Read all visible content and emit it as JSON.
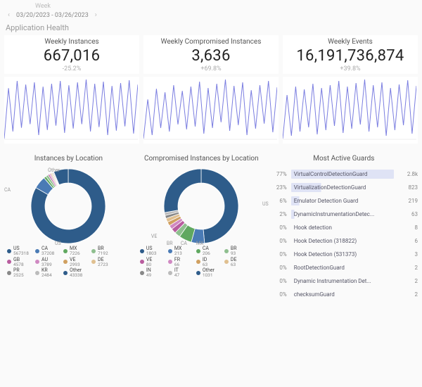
{
  "header": {
    "week_label": "Week",
    "date_range": "03/20/2023 - 03/26/2023"
  },
  "section_title": "Application Health",
  "kpis": [
    {
      "title": "Weekly Instances",
      "value": "667,016",
      "delta": "-25.2%"
    },
    {
      "title": "Weekly Compromised Instances",
      "value": "3,636",
      "delta": "+69.8%"
    },
    {
      "title": "Weekly Events",
      "value": "16,191,736,874",
      "delta": "+39.8%"
    }
  ],
  "donut_titles": {
    "left": "Instances by Location",
    "mid": "Compromised Instances by Location"
  },
  "guards_title": "Most Active Guards",
  "colors": {
    "spark_stroke": "#7a7de0",
    "palette": [
      "#2e5c8a",
      "#4a7bb5",
      "#60a860",
      "#8fbf8f",
      "#b85c9e",
      "#d089c2",
      "#d0a060",
      "#e0c090",
      "#888888",
      "#bbbbbb"
    ]
  },
  "chart_data": {
    "sparklines": [
      {
        "name": "Weekly Instances",
        "type": "line",
        "values": [
          10,
          80,
          20,
          90,
          25,
          85,
          30,
          88,
          15,
          82,
          22,
          86,
          28,
          90,
          18,
          84,
          24,
          88,
          30,
          92,
          20,
          86,
          26,
          89,
          15,
          83,
          21,
          87,
          27,
          91,
          17,
          85
        ]
      },
      {
        "name": "Weekly Compromised Instances",
        "type": "line",
        "values": [
          5,
          60,
          10,
          75,
          20,
          70,
          15,
          80,
          25,
          72,
          18,
          78,
          22,
          85,
          12,
          76,
          20,
          82,
          28,
          88,
          16,
          79,
          24,
          84,
          10,
          73,
          19,
          80,
          26,
          86,
          14,
          77
        ]
      },
      {
        "name": "Weekly Events",
        "type": "line",
        "values": [
          8,
          70,
          12,
          82,
          18,
          78,
          24,
          86,
          14,
          80,
          20,
          84,
          26,
          90,
          16,
          82,
          22,
          87,
          28,
          92,
          18,
          84,
          24,
          88,
          12,
          80,
          20,
          85,
          27,
          91,
          15,
          83
        ]
      }
    ],
    "instances_by_location": {
      "type": "donut",
      "items": [
        {
          "label": "US",
          "value": 567318
        },
        {
          "label": "CA",
          "value": 37208
        },
        {
          "label": "MX",
          "value": 7226
        },
        {
          "label": "BR",
          "value": 7192
        },
        {
          "label": "GB",
          "value": 4578
        },
        {
          "label": "AU",
          "value": 3789
        },
        {
          "label": "VE",
          "value": 2993
        },
        {
          "label": "DE",
          "value": 2723
        },
        {
          "label": "PR",
          "value": 2525
        },
        {
          "label": "KR",
          "value": 2484
        },
        {
          "label": "Other",
          "value": 43338
        }
      ],
      "annotations": [
        "Other",
        "CA",
        "US"
      ]
    },
    "compromised_by_location": {
      "type": "donut",
      "items": [
        {
          "label": "US",
          "value": 1803
        },
        {
          "label": "MX",
          "value": 213
        },
        {
          "label": "CA",
          "value": 206
        },
        {
          "label": "BR",
          "value": 93
        },
        {
          "label": "VE",
          "value": 80
        },
        {
          "label": "FR",
          "value": 66
        },
        {
          "label": "ID",
          "value": 63
        },
        {
          "label": "DE",
          "value": 63
        },
        {
          "label": "IN",
          "value": 49
        },
        {
          "label": "IT",
          "value": 47
        },
        {
          "label": "Other",
          "value": 1031
        }
      ],
      "annotations": [
        "US",
        "VE",
        "BR",
        "CA",
        "MX"
      ]
    },
    "most_active_guards": {
      "type": "table",
      "rows": [
        {
          "pct": "77%",
          "name": "VirtualControlDetectionGuard",
          "count": "2.8k",
          "barFrac": 1.0
        },
        {
          "pct": "23%",
          "name": "VirtualizationDetectionGuard",
          "count": "823",
          "barFrac": 0.29
        },
        {
          "pct": "6%",
          "name": "Emulator Detection Guard",
          "count": "219",
          "barFrac": 0.08
        },
        {
          "pct": "2%",
          "name": "DynamicInstrumentationDetec...",
          "count": "63",
          "barFrac": 0.03
        },
        {
          "pct": "0%",
          "name": "Hook detection",
          "count": "8",
          "barFrac": 0
        },
        {
          "pct": "0%",
          "name": "Hook Detection (318822)",
          "count": "6",
          "barFrac": 0
        },
        {
          "pct": "0%",
          "name": "Hook Detection (531373)",
          "count": "3",
          "barFrac": 0
        },
        {
          "pct": "0%",
          "name": "RootDetectionGuard",
          "count": "2",
          "barFrac": 0
        },
        {
          "pct": "0%",
          "name": "Dynamic Instrumentation Det...",
          "count": "2",
          "barFrac": 0
        },
        {
          "pct": "0%",
          "name": "checksumGuard",
          "count": "2",
          "barFrac": 0
        }
      ]
    }
  }
}
